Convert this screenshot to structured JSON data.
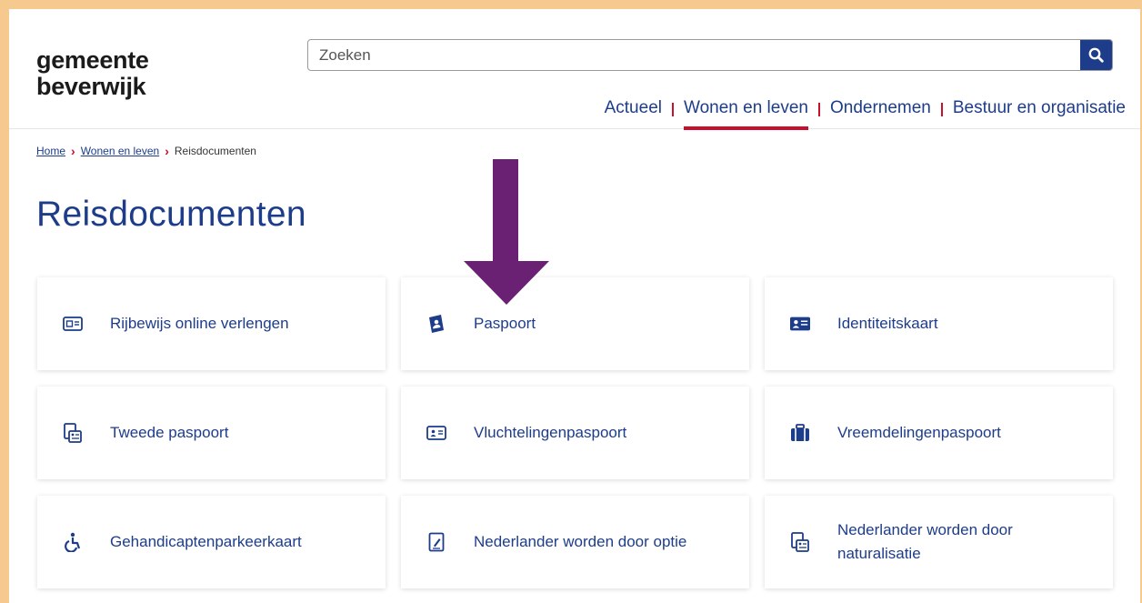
{
  "logo": {
    "line1": "gemeente",
    "line2": "beverwijk"
  },
  "search": {
    "placeholder": "Zoeken"
  },
  "nav": [
    {
      "label": "Actueel"
    },
    {
      "label": "Wonen en leven"
    },
    {
      "label": "Ondernemen"
    },
    {
      "label": "Bestuur en organisatie"
    }
  ],
  "breadcrumb": {
    "home": "Home",
    "wonen": "Wonen en leven",
    "current": "Reisdocumenten"
  },
  "page": {
    "title": "Reisdocumenten"
  },
  "cards": [
    {
      "label": "Rijbewijs online verlengen",
      "icon": "drivers-license-icon"
    },
    {
      "label": "Paspoort",
      "icon": "passport-icon"
    },
    {
      "label": "Identiteitskaart",
      "icon": "id-card-icon"
    },
    {
      "label": "Tweede paspoort",
      "icon": "second-passport-icon"
    },
    {
      "label": "Vluchtelingenpaspoort",
      "icon": "refugee-passport-icon"
    },
    {
      "label": "Vreemdelingenpaspoort",
      "icon": "suitcase-icon"
    },
    {
      "label": "Gehandicaptenparkeerkaart",
      "icon": "wheelchair-icon"
    },
    {
      "label": "Nederlander worden door optie",
      "icon": "document-icon"
    },
    {
      "label": "Nederlander worden door naturalisatie",
      "icon": "naturalization-icon"
    }
  ],
  "colors": {
    "brand": "#1d3c8a",
    "accent": "#c8102e",
    "arrow": "#6b2173",
    "border": "#f6c98f"
  }
}
